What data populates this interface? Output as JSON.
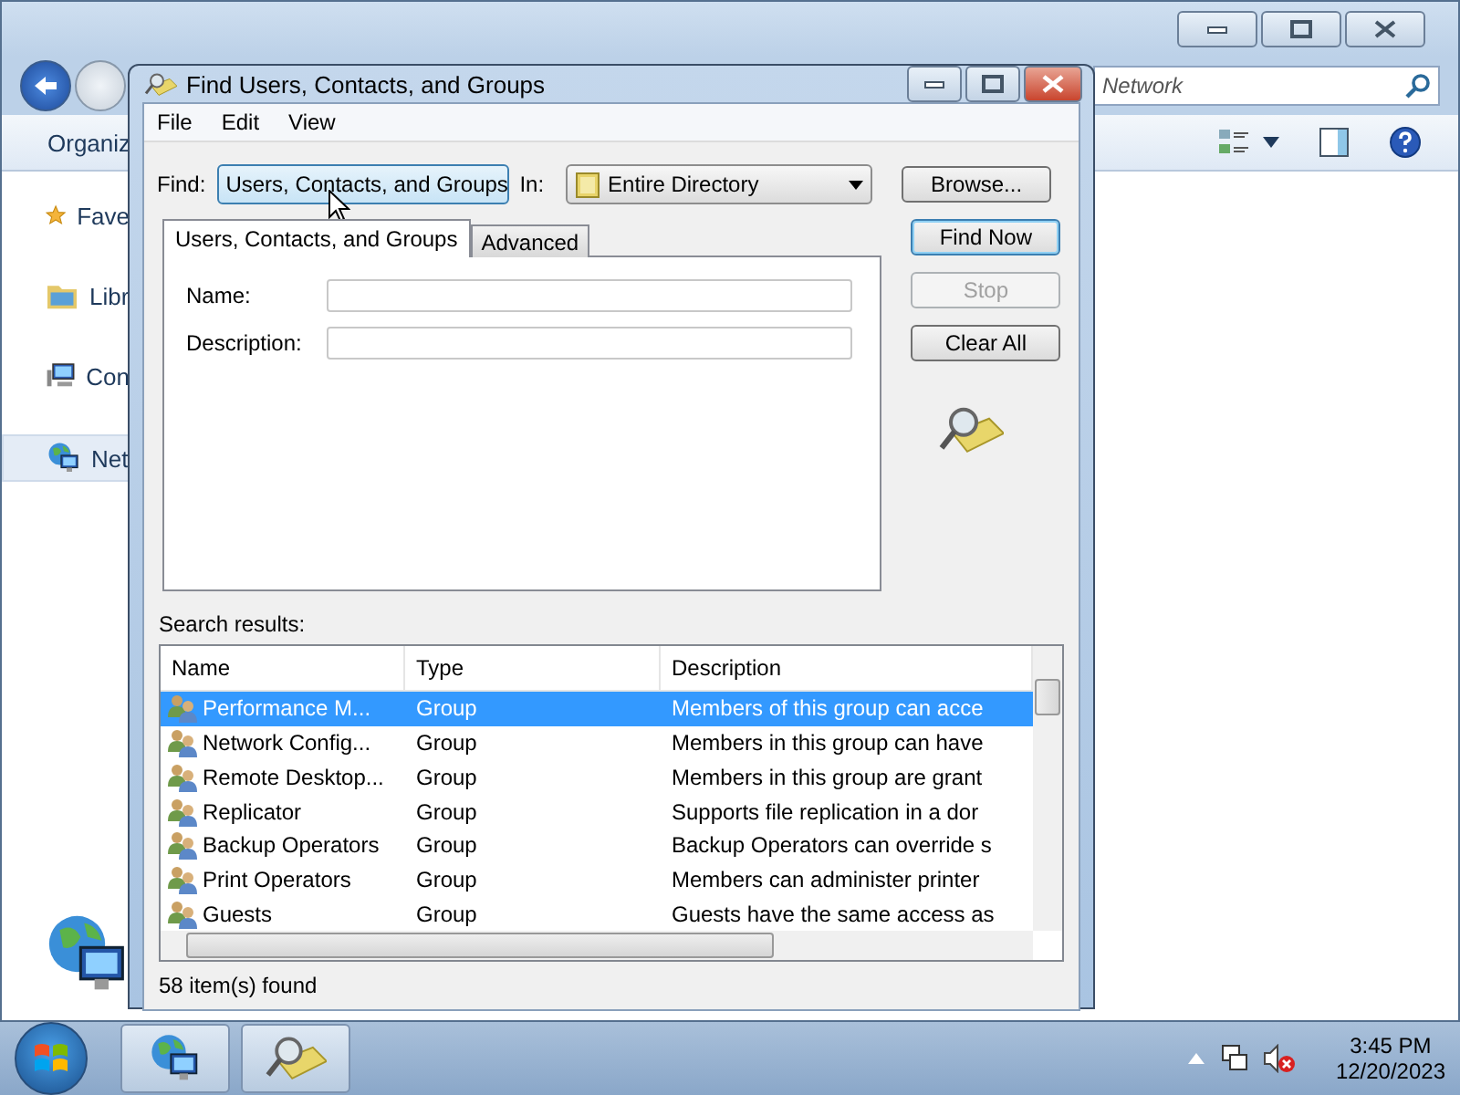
{
  "explorer": {
    "search": {
      "value": "Network"
    },
    "toolbar": {
      "organize": "Organiz"
    },
    "nav_items": [
      {
        "label": "Fave",
        "kind": "favorites",
        "selected": false
      },
      {
        "label": "Libr",
        "kind": "libraries",
        "selected": false
      },
      {
        "label": "Con",
        "kind": "computer",
        "selected": false
      },
      {
        "label": "Net",
        "kind": "network",
        "selected": true
      }
    ]
  },
  "dialog": {
    "title": "Find Users, Contacts, and Groups",
    "menu": [
      "File",
      "Edit",
      "View"
    ],
    "find": {
      "label": "Find:",
      "value": "Users, Contacts, and Groups"
    },
    "in": {
      "label": "In:",
      "value": "Entire Directory"
    },
    "browse": "Browse...",
    "tabs": [
      {
        "label": "Users, Contacts, and Groups",
        "selected": true
      },
      {
        "label": "Advanced",
        "selected": false
      }
    ],
    "fields": [
      {
        "label": "Name:"
      },
      {
        "label": "Description:"
      }
    ],
    "buttons": [
      {
        "label": "Find Now",
        "disabled": false,
        "default": true
      },
      {
        "label": "Stop",
        "disabled": true,
        "default": false
      },
      {
        "label": "Clear All",
        "disabled": false,
        "default": false
      }
    ],
    "results_label": "Search results:",
    "table": {
      "columns": [
        "Name",
        "Type",
        "Description"
      ],
      "rows": [
        {
          "name": "Performance M...",
          "type": "Group",
          "description": "Members of this group can acce",
          "selected": true
        },
        {
          "name": "Network Config...",
          "type": "Group",
          "description": "Members in this group can have",
          "selected": false
        },
        {
          "name": "Remote Desktop...",
          "type": "Group",
          "description": "Members in this group are grant",
          "selected": false
        },
        {
          "name": "Replicator",
          "type": "Group",
          "description": "Supports file replication in a dor",
          "selected": false
        },
        {
          "name": "Backup Operators",
          "type": "Group",
          "description": "Backup Operators can override s",
          "selected": false
        },
        {
          "name": "Print Operators",
          "type": "Group",
          "description": "Members can administer printer",
          "selected": false
        },
        {
          "name": "Guests",
          "type": "Group",
          "description": "Guests have the same access as",
          "selected": false
        }
      ]
    },
    "status": "58 item(s) found"
  },
  "taskbar": {
    "items": [
      {
        "kind": "network"
      },
      {
        "kind": "search"
      }
    ],
    "clock": {
      "time": "3:45 PM",
      "date": "12/20/2023"
    }
  }
}
